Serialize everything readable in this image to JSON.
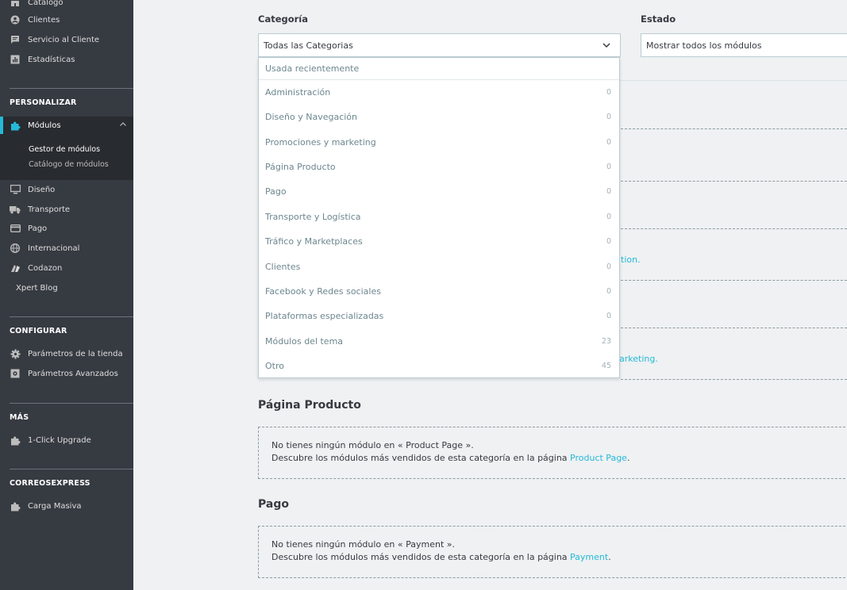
{
  "sidebar": {
    "top_items": [
      {
        "label": "Catálogo",
        "icon": "store-icon"
      },
      {
        "label": "Clientes",
        "icon": "account-circle-icon"
      },
      {
        "label": "Servicio al Cliente",
        "icon": "chat-icon"
      },
      {
        "label": "Estadísticas",
        "icon": "bar-chart-icon"
      }
    ],
    "section_personalizar": "PERSONALIZAR",
    "modules_label": "Módulos",
    "modules_sub": [
      "Gestor de módulos",
      "Catálogo de módulos"
    ],
    "personalizar_items": [
      {
        "label": "Diseño",
        "icon": "monitor-icon"
      },
      {
        "label": "Transporte",
        "icon": "truck-icon"
      },
      {
        "label": "Pago",
        "icon": "credit-card-icon"
      },
      {
        "label": "Internacional",
        "icon": "globe-icon"
      },
      {
        "label": "Codazon",
        "icon": "codazon-icon"
      },
      {
        "label": "Xpert Blog",
        "icon": ""
      }
    ],
    "section_configurar": "CONFIGURAR",
    "configurar_items": [
      {
        "label": "Parámetros de la tienda",
        "icon": "gear-icon"
      },
      {
        "label": "Parámetros Avanzados",
        "icon": "settings-box-icon"
      }
    ],
    "section_mas": "MÁS",
    "mas_items": [
      {
        "label": "1-Click Upgrade",
        "icon": "puzzle-icon"
      }
    ],
    "section_correos": "CORREOSEXPRESS",
    "correos_items": [
      {
        "label": "Carga Masiva",
        "icon": "puzzle-icon"
      }
    ]
  },
  "filters": {
    "category_label": "Categoría",
    "category_value": "Todas las Categorias",
    "state_label": "Estado",
    "state_value": "Mostrar todos los módulos"
  },
  "dropdown": {
    "recent": "Usada recientemente",
    "items": [
      {
        "label": "Administración",
        "count": "0"
      },
      {
        "label": "Diseño y Navegación",
        "count": "0"
      },
      {
        "label": "Promociones y marketing",
        "count": "0"
      },
      {
        "label": "Página Producto",
        "count": "0"
      },
      {
        "label": "Pago",
        "count": "0"
      },
      {
        "label": "Transporte y Logística",
        "count": "0"
      },
      {
        "label": "Tráfico y Marketplaces",
        "count": "0"
      },
      {
        "label": "Clientes",
        "count": "0"
      },
      {
        "label": "Facebook y Redes sociales",
        "count": "0"
      },
      {
        "label": "Plataformas especializadas",
        "count": "0"
      },
      {
        "label": "Módulos del tema",
        "count": "23"
      },
      {
        "label": "Otro",
        "count": "45"
      }
    ]
  },
  "peek": {
    "link1": "tion.",
    "link2": "arketing."
  },
  "sections": [
    {
      "title": "Página Producto",
      "line1": "No tienes ningún módulo en « Product Page ».",
      "line2_prefix": "Descubre los módulos más vendidos de esta categoría en la página ",
      "link": "Product Page",
      "suffix": "."
    },
    {
      "title": "Pago",
      "line1": "No tienes ningún módulo en « Payment ».",
      "line2_prefix": "Descubre los módulos más vendidos de esta categoría en la página ",
      "link": "Payment",
      "suffix": "."
    }
  ],
  "colors": {
    "accent": "#25b9d7",
    "sidebar_bg": "#363a41"
  }
}
